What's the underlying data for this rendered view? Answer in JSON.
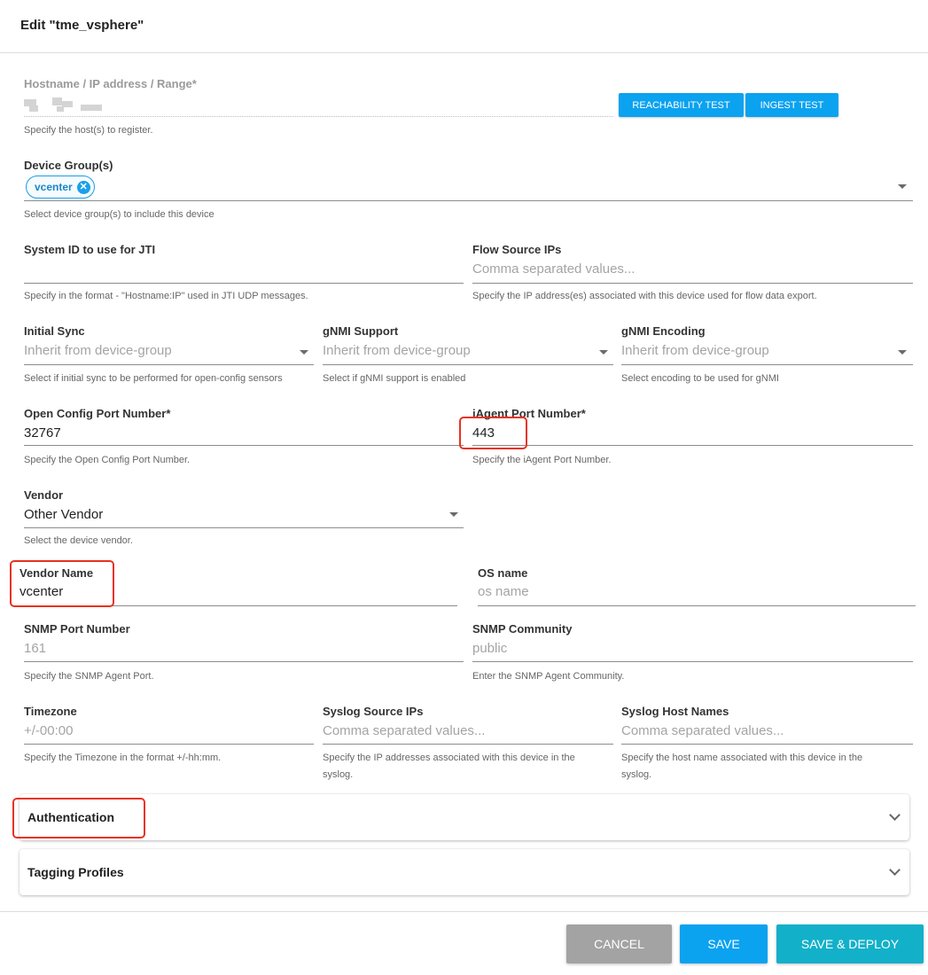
{
  "dialog": {
    "title": "Edit \"tme_vsphere\""
  },
  "hostname": {
    "label": "Hostname / IP address / Range*",
    "helper": "Specify the host(s) to register.",
    "reachability_label": "REACHABILITY TEST",
    "ingest_label": "INGEST TEST"
  },
  "device_groups": {
    "label": "Device Group(s)",
    "chips": [
      "vcenter"
    ],
    "helper": "Select device group(s) to include this device"
  },
  "system_id": {
    "label": "System ID to use for JTI",
    "value": "",
    "helper": "Specify in the format - \"Hostname:IP\" used in JTI UDP messages."
  },
  "flow_source": {
    "label": "Flow Source IPs",
    "placeholder": "Comma separated values...",
    "helper": "Specify the IP address(es) associated with this device used for flow data export."
  },
  "initial_sync": {
    "label": "Initial Sync",
    "value": "Inherit from device-group",
    "helper": "Select if initial sync to be performed for open-config sensors"
  },
  "gnmi_support": {
    "label": "gNMI Support",
    "value": "Inherit from device-group",
    "helper": "Select if gNMI support is enabled"
  },
  "gnmi_encoding": {
    "label": "gNMI Encoding",
    "value": "Inherit from device-group",
    "helper": "Select encoding to be used for gNMI"
  },
  "open_config_port": {
    "label": "Open Config Port Number*",
    "value": "32767",
    "helper": "Specify the Open Config Port Number."
  },
  "iagent_port": {
    "label": "iAgent Port Number*",
    "value": "443",
    "helper": "Specify the iAgent Port Number."
  },
  "vendor": {
    "label": "Vendor",
    "value": "Other Vendor",
    "helper": "Select the device vendor."
  },
  "vendor_name": {
    "label": "Vendor Name",
    "value": "vcenter"
  },
  "os_name": {
    "label": "OS name",
    "placeholder": "os name"
  },
  "snmp_port": {
    "label": "SNMP Port Number",
    "placeholder": "161",
    "helper": "Specify the SNMP Agent Port."
  },
  "snmp_community": {
    "label": "SNMP Community",
    "placeholder": "public",
    "helper": "Enter the SNMP Agent Community."
  },
  "timezone": {
    "label": "Timezone",
    "placeholder": "+/-00:00",
    "helper": "Specify the Timezone in the format +/-hh:mm."
  },
  "syslog_source": {
    "label": "Syslog Source IPs",
    "placeholder": "Comma separated values...",
    "helper_line1": "Specify the IP addresses associated with this device in the",
    "helper_line2": "syslog."
  },
  "syslog_hosts": {
    "label": "Syslog Host Names",
    "placeholder": "Comma separated values...",
    "helper_line1": "Specify the host name associated with this device in the",
    "helper_line2": "syslog."
  },
  "panels": {
    "authentication": "Authentication",
    "tagging": "Tagging Profiles"
  },
  "footer": {
    "cancel": "CANCEL",
    "save": "SAVE",
    "save_deploy": "SAVE & DEPLOY"
  },
  "colors": {
    "primary": "#0ba2f0",
    "deploy": "#13b0c9",
    "cancel": "#a3a3a3",
    "highlight": "#e8321f"
  }
}
